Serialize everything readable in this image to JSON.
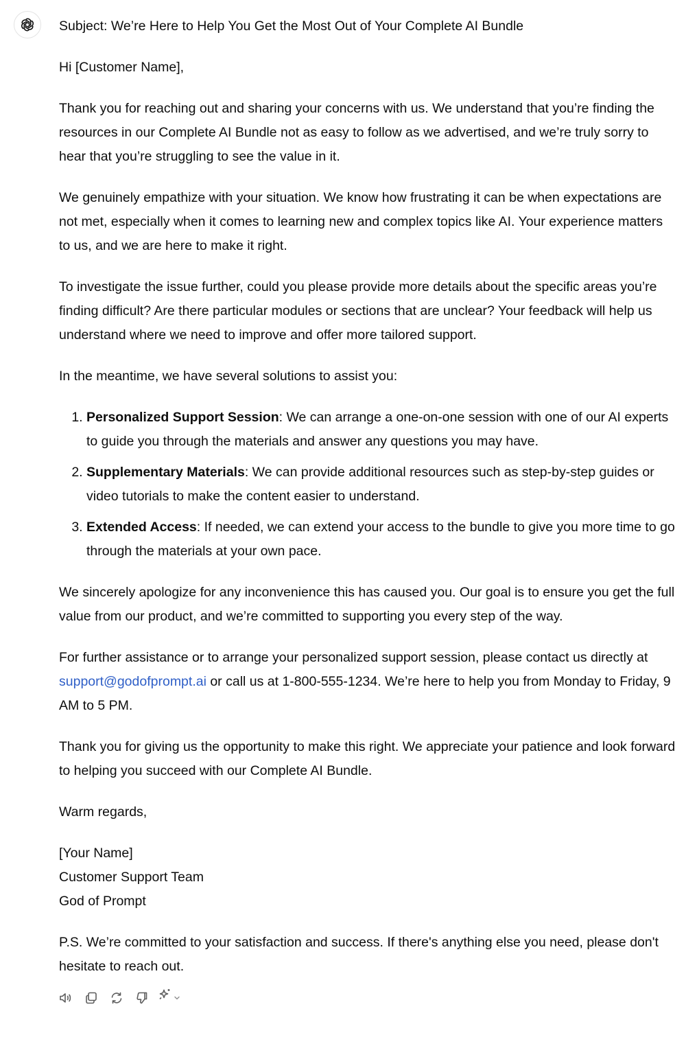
{
  "assistant": {
    "avatar_icon": "openai-logo-icon"
  },
  "email": {
    "subject": "Subject: We’re Here to Help You Get the Most Out of Your Complete AI Bundle",
    "greeting": "Hi [Customer Name],",
    "paragraph_1": "Thank you for reaching out and sharing your concerns with us. We understand that you’re finding the resources in our Complete AI Bundle not as easy to follow as we advertised, and we’re truly sorry to hear that you’re struggling to see the value in it.",
    "paragraph_2": "We genuinely empathize with your situation. We know how frustrating it can be when expectations are not met, especially when it comes to learning new and complex topics like AI. Your experience matters to us, and we are here to make it right.",
    "paragraph_3": "To investigate the issue further, could you please provide more details about the specific areas you’re finding difficult? Are there particular modules or sections that are unclear? Your feedback will help us understand where we need to improve and offer more tailored support.",
    "solutions_intro": "In the meantime, we have several solutions to assist you:",
    "solutions": [
      {
        "title": "Personalized Support Session",
        "text": ": We can arrange a one-on-one session with one of our AI experts to guide you through the materials and answer any questions you may have."
      },
      {
        "title": "Supplementary Materials",
        "text": ": We can provide additional resources such as step-by-step guides or video tutorials to make the content easier to understand."
      },
      {
        "title": "Extended Access",
        "text": ": If needed, we can extend your access to the bundle to give you more time to go through the materials at your own pace."
      }
    ],
    "paragraph_4": "We sincerely apologize for any inconvenience this has caused you. Our goal is to ensure you get the full value from our product, and we’re committed to supporting you every step of the way.",
    "contact_before": "For further assistance or to arrange your personalized support session, please contact us directly at ",
    "contact_email": "support@godofprompt.ai",
    "contact_after": " or call us at 1-800-555-1234. We’re here to help you from Monday to Friday, 9 AM to 5 PM.",
    "paragraph_6": "Thank you for giving us the opportunity to make this right. We appreciate your patience and look forward to helping you succeed with our Complete AI Bundle.",
    "closing": "Warm regards,",
    "signature": {
      "name": "[Your Name]",
      "team": "Customer Support Team",
      "company": "God of Prompt"
    },
    "postscript": "P.S. We’re committed to your satisfaction and success. If there's anything else you need, please don't hesitate to reach out."
  },
  "actions": {
    "read_aloud_icon": "speaker-icon",
    "copy_icon": "copy-icon",
    "regenerate_icon": "refresh-icon",
    "thumbs_down_icon": "thumbs-down-icon",
    "model_icon": "sparkle-icon",
    "model_chevron_icon": "chevron-down-icon"
  },
  "colors": {
    "text": "#0d0d0d",
    "link": "#2f5fc7",
    "icon": "#5d5d5d",
    "background": "#ffffff"
  }
}
